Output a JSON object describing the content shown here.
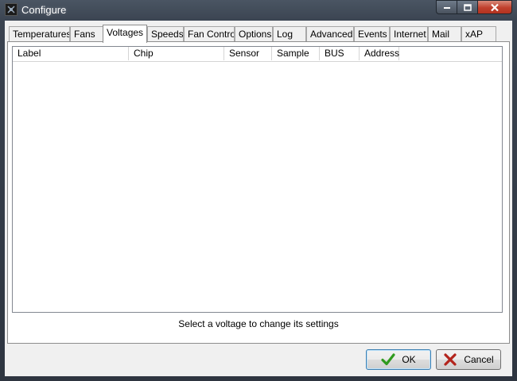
{
  "window": {
    "title": "Configure"
  },
  "tabs": [
    {
      "label": "Temperatures"
    },
    {
      "label": "Fans"
    },
    {
      "label": "Voltages"
    },
    {
      "label": "Speeds"
    },
    {
      "label": "Fan Control"
    },
    {
      "label": "Options"
    },
    {
      "label": "Log"
    },
    {
      "label": "Advanced"
    },
    {
      "label": "Events"
    },
    {
      "label": "Internet"
    },
    {
      "label": "Mail"
    },
    {
      "label": "xAP"
    }
  ],
  "active_tab": "Voltages",
  "list": {
    "columns": [
      "Label",
      "Chip",
      "Sensor",
      "Sample",
      "BUS",
      "Address"
    ],
    "rows": []
  },
  "status": "Select a voltage to change its settings",
  "buttons": {
    "ok": "OK",
    "cancel": "Cancel"
  },
  "colors": {
    "ok_check": "#2f9b1f",
    "cancel_x": "#b3241c",
    "title_text": "#ffffff"
  }
}
